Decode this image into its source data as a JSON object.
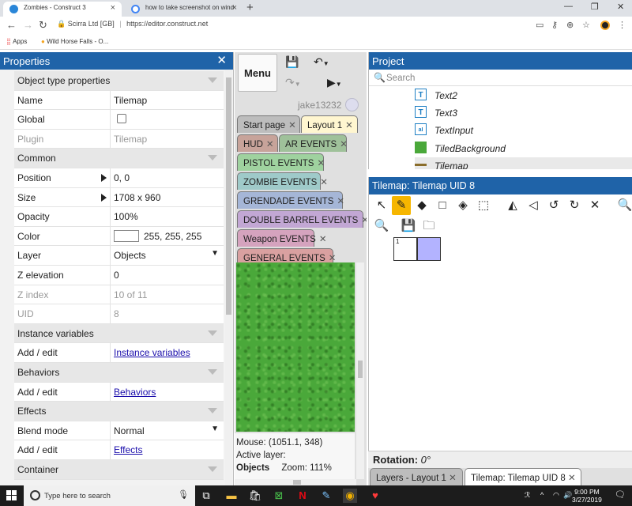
{
  "browser": {
    "tabs": [
      {
        "title": "Zombies - Construct 3",
        "active": true
      },
      {
        "title": "how to take screenshot on wind",
        "active": false
      }
    ],
    "new_tab": "+",
    "url_site": "Scirra Ltd [GB]",
    "url_separator": "|",
    "url": "https://editor.construct.net",
    "bookmarks": [
      "Apps",
      "Wild Horse Falls - O..."
    ]
  },
  "properties": {
    "title": "Properties",
    "close": "✕",
    "rows": [
      {
        "type": "section",
        "name": "Object type properties"
      },
      {
        "name": "Name",
        "value": "Tilemap"
      },
      {
        "name": "Global",
        "value": "",
        "kind": "checkbox"
      },
      {
        "name": "Plugin",
        "value": "Tilemap",
        "dim": true
      },
      {
        "type": "section",
        "name": "Common"
      },
      {
        "name": "Position",
        "value": "0, 0",
        "expand": true
      },
      {
        "name": "Size",
        "value": "1708 x 960",
        "expand": true
      },
      {
        "name": "Opacity",
        "value": "100%"
      },
      {
        "name": "Color",
        "value": "255, 255, 255",
        "kind": "color"
      },
      {
        "name": "Layer",
        "value": "Objects",
        "kind": "dropdown"
      },
      {
        "name": "Z elevation",
        "value": "0"
      },
      {
        "name": "Z index",
        "value": "10 of 11",
        "dim": true
      },
      {
        "name": "UID",
        "value": "8",
        "dim": true
      },
      {
        "type": "section",
        "name": "Instance variables"
      },
      {
        "name": "Add / edit",
        "value": "Instance variables",
        "kind": "link"
      },
      {
        "type": "section",
        "name": "Behaviors"
      },
      {
        "name": "Add / edit",
        "value": "Behaviors",
        "kind": "link"
      },
      {
        "type": "section",
        "name": "Effects"
      },
      {
        "name": "Blend mode",
        "value": "Normal",
        "kind": "dropdown"
      },
      {
        "name": "Add / edit",
        "value": "Effects",
        "kind": "link"
      },
      {
        "type": "section",
        "name": "Container"
      }
    ]
  },
  "toolbar": {
    "menu_label": "Menu",
    "username": "jake13232"
  },
  "layout_tabs": [
    {
      "label": "Start page",
      "color": "#bdbdbd"
    },
    {
      "label": "Layout 1",
      "color": "#fff6d0"
    },
    {
      "label": "HUD",
      "color": "#c7a39a"
    },
    {
      "label": "AR EVENTS",
      "color": "#9fc19a"
    },
    {
      "label": "PISTOL EVENTS",
      "color": "#9fd29f"
    },
    {
      "label": "ZOMBIE EVENTS",
      "color": "#9fcac9"
    },
    {
      "label": "GRENDADE EVENTS",
      "color": "#a5b6d7"
    },
    {
      "label": "DOUBLE BARREL EVENTS",
      "color": "#c2a7d4"
    },
    {
      "label": "Weapon EVENTS",
      "color": "#d5a3be"
    },
    {
      "label": "GENERAL EVENTS",
      "color": "#d9a0a0"
    }
  ],
  "status": {
    "mouse": "Mouse: (1051.1, 348)",
    "active_layer_label": "Active layer:",
    "active_layer": "Objects",
    "zoom": "Zoom: 111%"
  },
  "project": {
    "title": "Project",
    "search_placeholder": "Search",
    "items": [
      {
        "label": "Text2",
        "icon": "text-icon"
      },
      {
        "label": "Text3",
        "icon": "text-icon"
      },
      {
        "label": "TextInput",
        "icon": "textinput-icon"
      },
      {
        "label": "TiledBackground",
        "icon": "tiledbackground-icon"
      },
      {
        "label": "Tilemap",
        "icon": "tilemap-icon",
        "selected": true
      }
    ]
  },
  "tilemap_bar": {
    "title": "Tilemap: Tilemap UID 8",
    "tile_number": "1"
  },
  "rotation": {
    "label": "Rotation:",
    "value": "0°"
  },
  "bottom_tabs": [
    {
      "label": "Layers - Layout 1",
      "active": false
    },
    {
      "label": "Tilemap: Tilemap UID 8",
      "active": true
    }
  ],
  "taskbar": {
    "search_placeholder": "Type here to search",
    "time": "9:00 PM",
    "date": "3/27/2019"
  },
  "colors": {
    "panel_header": "#1f63a8",
    "active_tool": "#f6b600",
    "tile_selected": "#b3b3ff",
    "canvas_green": "#4aa83a"
  }
}
